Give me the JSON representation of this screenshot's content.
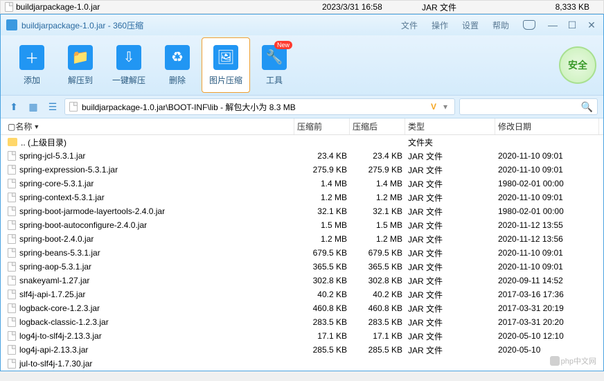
{
  "outer_explorer": {
    "filename": "buildjarpackage-1.0.jar",
    "date": "2023/3/31 16:58",
    "type": "JAR 文件",
    "size": "8,333 KB"
  },
  "window": {
    "title": "buildjarpackage-1.0.jar - 360压缩",
    "menu": {
      "file": "文件",
      "operation": "操作",
      "settings": "设置",
      "help": "帮助"
    }
  },
  "toolbar": {
    "add": "添加",
    "extract": "解压到",
    "oneclick": "一键解压",
    "delete": "删除",
    "image_compress": "图片压缩",
    "tools": "工具",
    "new_badge": "New",
    "safe": "安全"
  },
  "pathbar": {
    "path": "buildjarpackage-1.0.jar\\BOOT-INF\\lib - 解包大小为 8.3 MB",
    "drop_letter": "V"
  },
  "columns": {
    "name": "名称",
    "before": "压缩前",
    "after": "压缩后",
    "type": "类型",
    "date": "修改日期"
  },
  "files": [
    {
      "icon": "folder",
      "name": ".. (上级目录)",
      "before": "",
      "after": "",
      "type": "文件夹",
      "date": ""
    },
    {
      "icon": "file",
      "name": "spring-jcl-5.3.1.jar",
      "before": "23.4 KB",
      "after": "23.4 KB",
      "type": "JAR 文件",
      "date": "2020-11-10 09:01"
    },
    {
      "icon": "file",
      "name": "spring-expression-5.3.1.jar",
      "before": "275.9 KB",
      "after": "275.9 KB",
      "type": "JAR 文件",
      "date": "2020-11-10 09:01"
    },
    {
      "icon": "file",
      "name": "spring-core-5.3.1.jar",
      "before": "1.4 MB",
      "after": "1.4 MB",
      "type": "JAR 文件",
      "date": "1980-02-01 00:00"
    },
    {
      "icon": "file",
      "name": "spring-context-5.3.1.jar",
      "before": "1.2 MB",
      "after": "1.2 MB",
      "type": "JAR 文件",
      "date": "2020-11-10 09:01"
    },
    {
      "icon": "file",
      "name": "spring-boot-jarmode-layertools-2.4.0.jar",
      "before": "32.1 KB",
      "after": "32.1 KB",
      "type": "JAR 文件",
      "date": "1980-02-01 00:00"
    },
    {
      "icon": "file",
      "name": "spring-boot-autoconfigure-2.4.0.jar",
      "before": "1.5 MB",
      "after": "1.5 MB",
      "type": "JAR 文件",
      "date": "2020-11-12 13:55"
    },
    {
      "icon": "file",
      "name": "spring-boot-2.4.0.jar",
      "before": "1.2 MB",
      "after": "1.2 MB",
      "type": "JAR 文件",
      "date": "2020-11-12 13:56"
    },
    {
      "icon": "file",
      "name": "spring-beans-5.3.1.jar",
      "before": "679.5 KB",
      "after": "679.5 KB",
      "type": "JAR 文件",
      "date": "2020-11-10 09:01"
    },
    {
      "icon": "file",
      "name": "spring-aop-5.3.1.jar",
      "before": "365.5 KB",
      "after": "365.5 KB",
      "type": "JAR 文件",
      "date": "2020-11-10 09:01"
    },
    {
      "icon": "file",
      "name": "snakeyaml-1.27.jar",
      "before": "302.8 KB",
      "after": "302.8 KB",
      "type": "JAR 文件",
      "date": "2020-09-11 14:52"
    },
    {
      "icon": "file",
      "name": "slf4j-api-1.7.25.jar",
      "before": "40.2 KB",
      "after": "40.2 KB",
      "type": "JAR 文件",
      "date": "2017-03-16 17:36"
    },
    {
      "icon": "file",
      "name": "logback-core-1.2.3.jar",
      "before": "460.8 KB",
      "after": "460.8 KB",
      "type": "JAR 文件",
      "date": "2017-03-31 20:19"
    },
    {
      "icon": "file",
      "name": "logback-classic-1.2.3.jar",
      "before": "283.5 KB",
      "after": "283.5 KB",
      "type": "JAR 文件",
      "date": "2017-03-31 20:20"
    },
    {
      "icon": "file",
      "name": "log4j-to-slf4j-2.13.3.jar",
      "before": "17.1 KB",
      "after": "17.1 KB",
      "type": "JAR 文件",
      "date": "2020-05-10 12:10"
    },
    {
      "icon": "file",
      "name": "log4j-api-2.13.3.jar",
      "before": "285.5 KB",
      "after": "285.5 KB",
      "type": "JAR 文件",
      "date": "2020-05-10"
    },
    {
      "icon": "file",
      "name": "jul-to-slf4j-1.7.30.jar",
      "before": "",
      "after": "",
      "type": "",
      "date": ""
    }
  ],
  "watermark": "php中文网"
}
